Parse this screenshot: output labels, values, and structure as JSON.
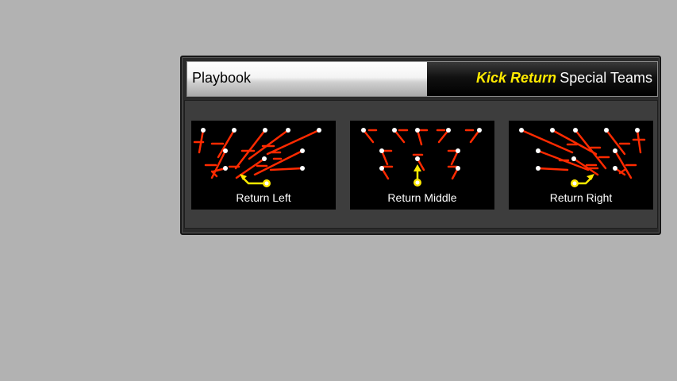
{
  "header": {
    "title": "Playbook",
    "mode": "Kick Return",
    "category": "Special Teams"
  },
  "plays": [
    {
      "label": "Return Left",
      "route_icon": "return-left-diagram"
    },
    {
      "label": "Return Middle",
      "route_icon": "return-middle-diagram"
    },
    {
      "label": "Return Right",
      "route_icon": "return-right-diagram"
    }
  ],
  "colors": {
    "background": "#b2b2b2",
    "panel": "#2b2b2b",
    "mode_text": "#ffea00",
    "blocking_routes": "#ff2a00",
    "returner": "#ffea00",
    "players": "#ffffff"
  }
}
